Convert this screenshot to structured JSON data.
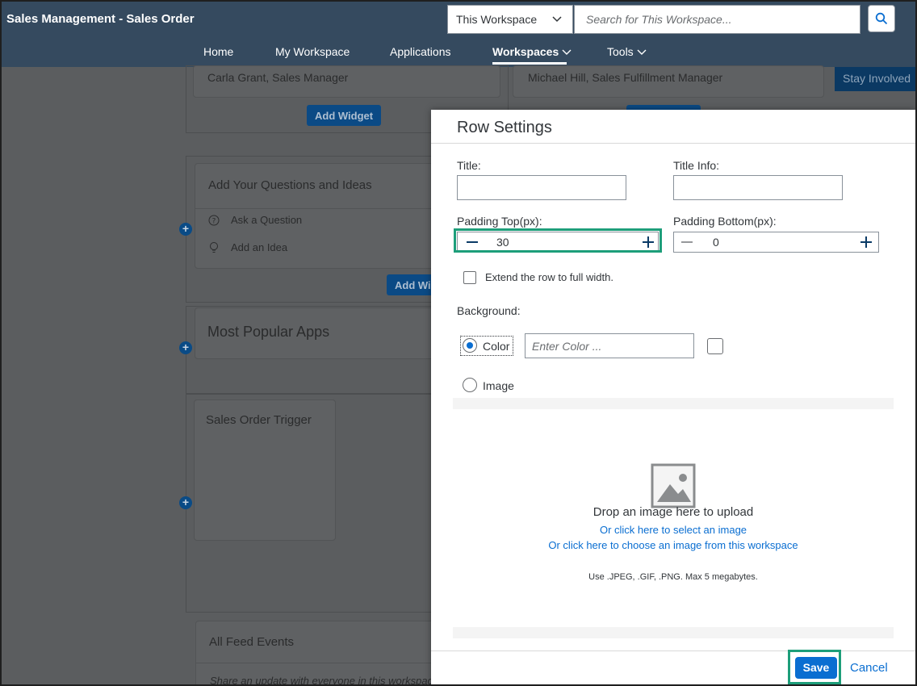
{
  "header": {
    "title": "Sales Management - Sales Order",
    "scope_select": "This Workspace",
    "search_placeholder": "Search for This Workspace...",
    "nav": {
      "home": "Home",
      "my_workspace": "My Workspace",
      "applications": "Applications",
      "workspaces": "Workspaces",
      "tools": "Tools"
    }
  },
  "background": {
    "person_left": "Carla Grant, Sales Manager",
    "person_right": "Michael Hill, Sales Fulfillment Manager",
    "stay_involved": "Stay Involved",
    "add_widget": "Add Widget",
    "add_widget_partial": "Add Wi",
    "questions_title": "Add Your Questions and Ideas",
    "ask_question": "Ask a Question",
    "add_idea": "Add an Idea",
    "popular_apps": "Most Popular Apps",
    "sales_order_trigger": "Sales Order Trigger",
    "feed_title": "All Feed Events",
    "feed_placeholder": "Share an update with everyone in this workspace..."
  },
  "dialog": {
    "title": "Row Settings",
    "title_label": "Title:",
    "title_info_label": "Title Info:",
    "padding_top_label": "Padding Top(px):",
    "padding_top_value": "30",
    "padding_bottom_label": "Padding Bottom(px):",
    "padding_bottom_value": "0",
    "extend_label": "Extend the row to full width.",
    "background_label": "Background:",
    "color_option": "Color",
    "color_placeholder": "Enter Color ...",
    "image_option": "Image",
    "drop_text": "Drop an image here to upload",
    "select_link": "Or click here to select an image",
    "choose_link": "Or click here to choose an image from this workspace",
    "hint": "Use .JPEG, .GIF, .PNG. Max 5 megabytes.",
    "save": "Save",
    "cancel": "Cancel"
  },
  "colors": {
    "shell": "#354a5f",
    "accent": "#0a6ed1",
    "highlight": "#1d9e7a"
  }
}
